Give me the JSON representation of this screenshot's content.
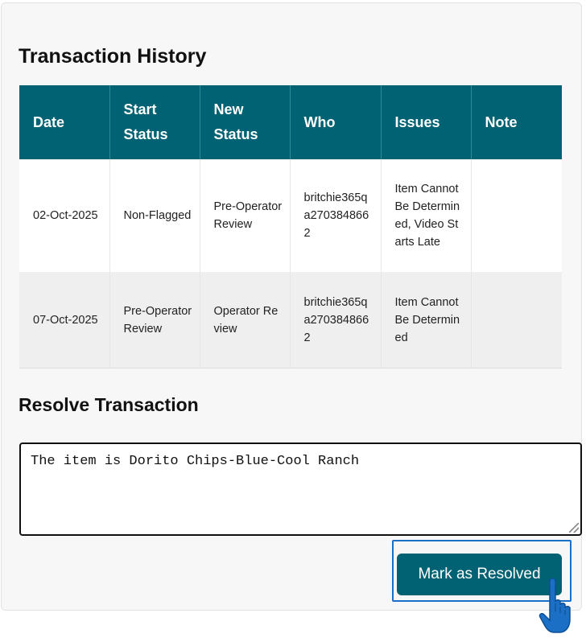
{
  "history": {
    "title": "Transaction History",
    "columns": [
      "Date",
      "Start Status",
      "New Status",
      "Who",
      "Issues",
      "Note"
    ],
    "rows": [
      [
        "02-Oct-2025",
        "Non-Flagged",
        "Pre-Operator Review",
        "britchie365qa2703848662",
        "Item Cannot Be Determined, Video Starts Late",
        ""
      ],
      [
        "07-Oct-2025",
        "Pre-Operator Review",
        "Operator Review",
        "britchie365qa2703848662",
        "Item Cannot Be Determined",
        ""
      ]
    ]
  },
  "resolve": {
    "title": "Resolve Transaction",
    "note_value": "The item is Dorito Chips-Blue-Cool Ranch",
    "button_label": "Mark as Resolved"
  },
  "colors": {
    "accent": "#006272",
    "focus": "#1a6fc9"
  },
  "icons": {
    "cursor": "hand-pointer-icon"
  }
}
